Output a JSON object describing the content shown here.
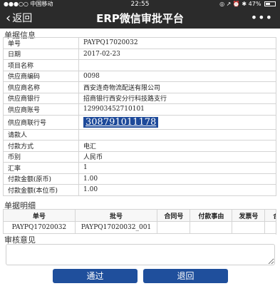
{
  "status_bar": {
    "carrier": "●●●○○ 中国移动",
    "time": "22:55",
    "battery": "47%"
  },
  "nav": {
    "back_label": "返回",
    "title": "ERP微信审批平台",
    "more_label": "•••"
  },
  "sections": {
    "info_title": "单据信息",
    "detail_title": "单据明细",
    "opinion_title": "审核意见"
  },
  "info_rows": [
    {
      "label": "单号",
      "value": "PAYPQ17020032"
    },
    {
      "label": "日期",
      "value": "2017-02-23"
    },
    {
      "label": "项目名称",
      "value": ""
    },
    {
      "label": "供应商编码",
      "value": "0098"
    },
    {
      "label": "供应商名称",
      "value": "西安连奇物流配送有限公司"
    },
    {
      "label": "供应商银行",
      "value": "招商银行西安分行科技路支行"
    },
    {
      "label": "供应商账号",
      "value": "129903452710101"
    },
    {
      "label": "供应商联行号",
      "value": "308791011178"
    },
    {
      "label": "请款人",
      "value": ""
    },
    {
      "label": "付款方式",
      "value": "电汇"
    },
    {
      "label": "币别",
      "value": "人民币"
    },
    {
      "label": "汇率",
      "value": "1"
    },
    {
      "label": "付款金额(原币)",
      "value": "1.00"
    },
    {
      "label": "付款金额(本位币)",
      "value": "1.00"
    }
  ],
  "detail_table": {
    "headers": [
      "单号",
      "批号",
      "合同号",
      "付款事由",
      "发票号",
      "合"
    ],
    "rows": [
      [
        "PAYPQ17020032",
        "PAYPQ17020032_001",
        "",
        "",
        "",
        ""
      ]
    ]
  },
  "buttons": {
    "approve": "通过",
    "reject": "退回"
  }
}
